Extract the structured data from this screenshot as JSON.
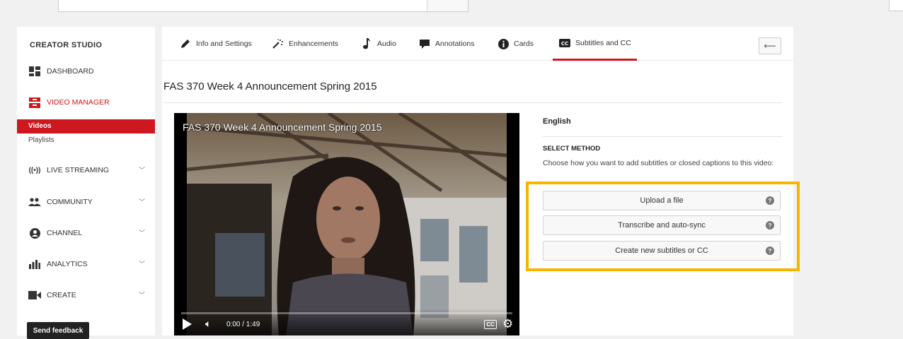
{
  "sidebar": {
    "title": "CREATOR STUDIO",
    "dashboard": "DASHBOARD",
    "video_manager": "VIDEO MANAGER",
    "videos": "Videos",
    "playlists": "Playlists",
    "live_streaming": "LIVE STREAMING",
    "community": "COMMUNITY",
    "channel": "CHANNEL",
    "analytics": "ANALYTICS",
    "create": "CREATE",
    "feedback": "Send feedback",
    "accent_color": "#cc181e"
  },
  "tabs": {
    "info": "Info and Settings",
    "enhancements": "Enhancements",
    "audio": "Audio",
    "annotations": "Annotations",
    "cards": "Cards",
    "subtitles": "Subtitles and CC",
    "active": "subtitles"
  },
  "video": {
    "title": "FAS 370 Week 4 Announcement Spring 2015",
    "overlay_title": "FAS 370 Week 4 Announcement Spring 2015",
    "time": "0:00 / 1:49",
    "cc_label": "CC"
  },
  "subtitles_panel": {
    "language": "English",
    "method_label": "SELECT METHOD",
    "method_desc": "Choose how you want to add subtitles or closed captions to this video:",
    "buttons": {
      "upload": "Upload a file",
      "transcribe": "Transcribe and auto-sync",
      "create": "Create new subtitles or CC"
    },
    "help_glyph": "?",
    "highlight_color": "#f7b500"
  }
}
